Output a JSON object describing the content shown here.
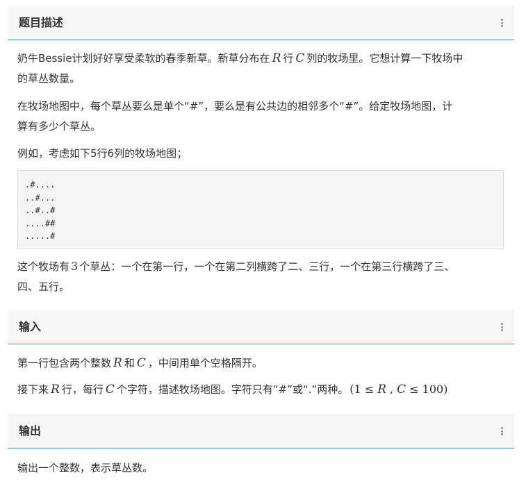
{
  "description": {
    "title": "题目描述",
    "para1": {
      "t1": "奶牛Bessie计划好好享受柔软的春季新草。新草分布在",
      "var_r": "R",
      "t2": "行",
      "var_c": "C",
      "t3": "列的牧场里。它想计算一下牧场中",
      "line2": "的草丛数量。"
    },
    "para2": {
      "line1": "在牧场地图中，每个草丛要么是单个“#”，要么是有公共边的相邻多个“#”。给定牧场地图，计",
      "line2": "算有多少个草丛。"
    },
    "para3": "例如，考虑如下5行6列的牧场地图；",
    "grid_rows": [
      ".#....",
      "..#...",
      "..#..#",
      "....##",
      ".....#"
    ],
    "para4": {
      "t1": "这个牧场有",
      "count": "3",
      "t2": "个草丛：一个在第一行，一个在第二列横跨了二、三行，一个在第三行横跨了三、",
      "line2": "四、五行。"
    }
  },
  "input": {
    "title": "输入",
    "para1": {
      "t1": "第一行包含两个整数",
      "var_r": "R",
      "t2": "和",
      "var_c": "C",
      "t3": "，中间用单个空格隔开。"
    },
    "para2": {
      "t1": "接下来",
      "var_r": "R",
      "t2": "行，每行",
      "var_c": "C",
      "t3": "个字符，描述牧场地图。字符只有“#”或“.”两种。",
      "constraint_open": "(1 ≤",
      "var_r2": "R",
      "comma": ",",
      "var_c2": "C",
      "constraint_close": "≤ 100)"
    }
  },
  "output": {
    "title": "输出",
    "para1": "输出一个整数，表示草丛数。"
  },
  "icons": {
    "more": "more-vertical-icon"
  },
  "colors": {
    "header_bg": "#f6f6f6",
    "header_border": "#3a8ec9",
    "code_bg": "#f5f5f5"
  }
}
